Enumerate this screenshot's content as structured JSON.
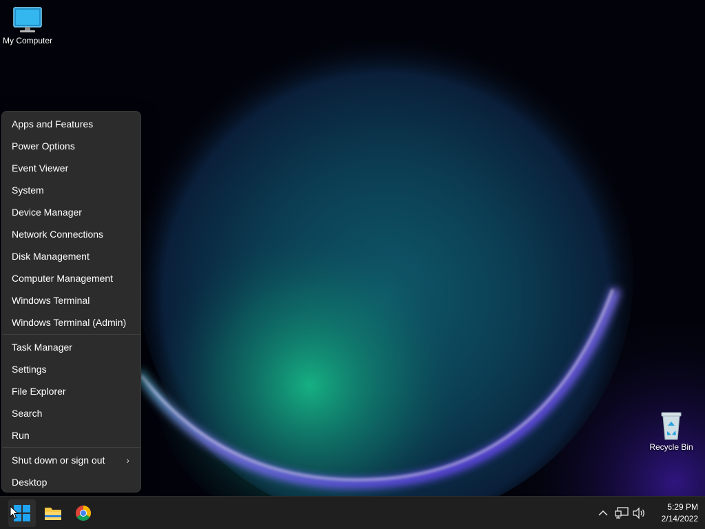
{
  "desktop": {
    "icons": [
      {
        "label": "My Computer",
        "icon": "monitor-icon"
      },
      {
        "label": "Recycle Bin",
        "icon": "recycle-bin-icon"
      }
    ]
  },
  "context_menu": {
    "groups": [
      [
        "Apps and Features",
        "Power Options",
        "Event Viewer",
        "System",
        "Device Manager",
        "Network Connections",
        "Disk Management",
        "Computer Management",
        "Windows Terminal",
        "Windows Terminal (Admin)"
      ],
      [
        "Task Manager",
        "Settings",
        "File Explorer",
        "Search",
        "Run"
      ],
      [
        "Shut down or sign out",
        "Desktop"
      ]
    ],
    "submenu_indicator": "›"
  },
  "taskbar": {
    "pinned": [
      {
        "icon": "windows-start-icon"
      },
      {
        "icon": "file-explorer-icon"
      },
      {
        "icon": "chrome-icon"
      }
    ],
    "tray": {
      "icons": [
        "chevron-up-icon",
        "network-icon",
        "volume-icon"
      ],
      "time": "5:29 PM",
      "date": "2/14/2022"
    }
  },
  "colors": {
    "menu_bg": "#2c2c2c",
    "taskbar_bg": "#1f1f1f",
    "accent": "#1fa3f2",
    "folder": "#f7c844"
  }
}
